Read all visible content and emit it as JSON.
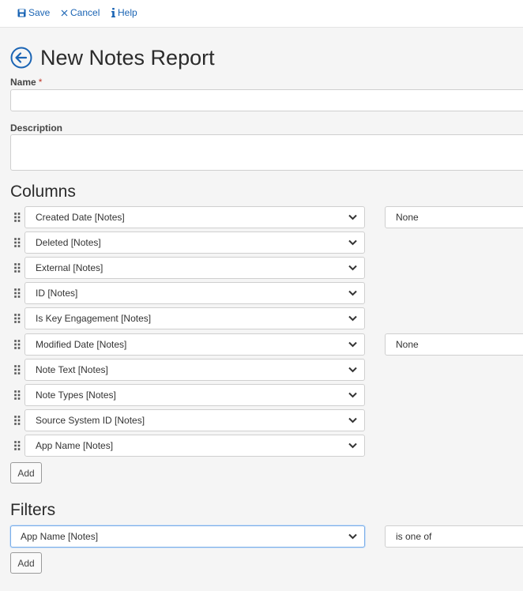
{
  "toolbar": {
    "save_label": "Save",
    "cancel_label": "Cancel",
    "help_label": "Help"
  },
  "page": {
    "title": "New Notes Report"
  },
  "form": {
    "name_label": "Name",
    "name_required_mark": "*",
    "name_value": "",
    "description_label": "Description",
    "description_value": ""
  },
  "columns": {
    "title": "Columns",
    "items": [
      "Created Date [Notes]",
      "Deleted [Notes]",
      "External [Notes]",
      "ID [Notes]",
      "Is Key Engagement [Notes]",
      "Modified Date [Notes]",
      "Note Text [Notes]",
      "Note Types [Notes]",
      "Source System ID [Notes]",
      "App Name [Notes]"
    ],
    "side_options": {
      "created_date": "None",
      "modified_date": "None"
    },
    "add_label": "Add"
  },
  "filters": {
    "title": "Filters",
    "field": "App Name [Notes]",
    "operator": "is one of",
    "add_label": "Add"
  },
  "colors": {
    "accent": "#1a64b4",
    "focus_border": "#7aaee8",
    "required": "#c0392b"
  }
}
